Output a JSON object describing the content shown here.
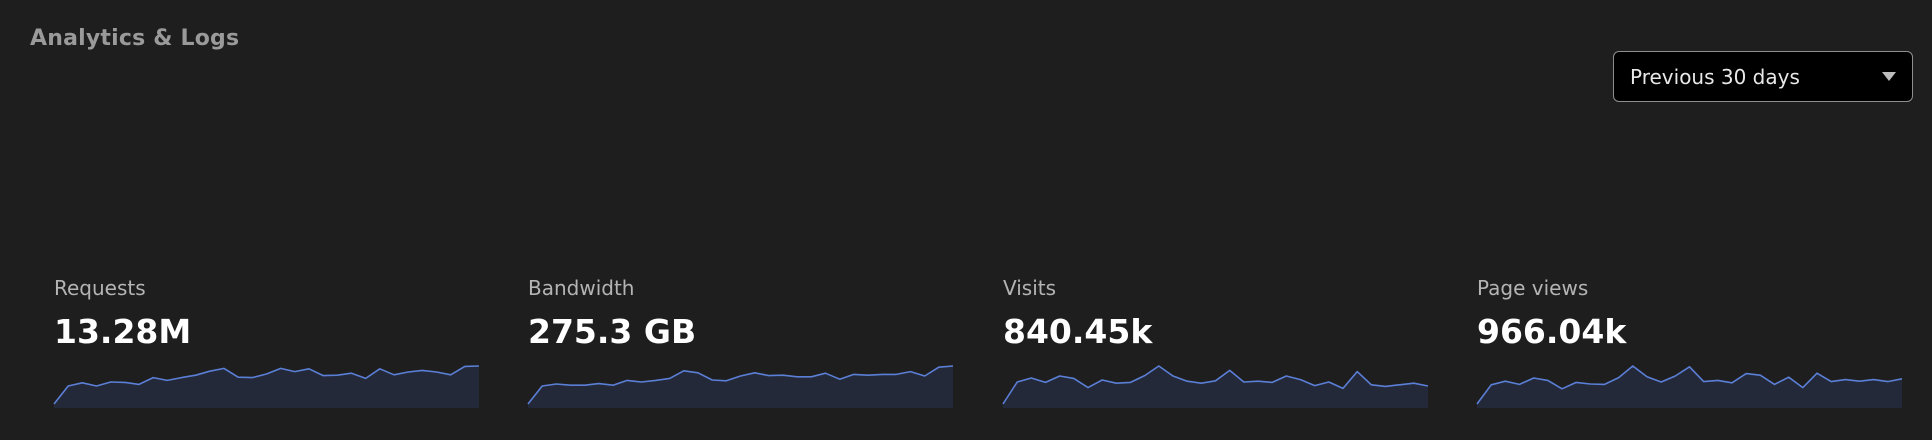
{
  "header": {
    "title": "Analytics & Logs"
  },
  "range_select": {
    "value": "Previous 30 days"
  },
  "colors": {
    "background": "#1e1e1e",
    "sparkline_stroke": "#5b7fd6",
    "sparkline_fill": "#232938"
  },
  "stats": [
    {
      "label": "Requests",
      "value": "13.28M",
      "trend": [
        0.05,
        0.5,
        0.58,
        0.5,
        0.6,
        0.59,
        0.54,
        0.71,
        0.64,
        0.71,
        0.77,
        0.87,
        0.94,
        0.72,
        0.71,
        0.8,
        0.94,
        0.86,
        0.93,
        0.76,
        0.77,
        0.82,
        0.69,
        0.93,
        0.78,
        0.85,
        0.89,
        0.85,
        0.78,
        0.99,
        1.0
      ]
    },
    {
      "label": "Bandwidth",
      "value": "275.3 GB",
      "trend": [
        0.05,
        0.5,
        0.55,
        0.52,
        0.52,
        0.56,
        0.52,
        0.64,
        0.6,
        0.64,
        0.69,
        0.88,
        0.83,
        0.65,
        0.63,
        0.75,
        0.83,
        0.76,
        0.77,
        0.73,
        0.73,
        0.82,
        0.67,
        0.79,
        0.77,
        0.79,
        0.79,
        0.86,
        0.75,
        0.97,
        1.0
      ]
    },
    {
      "label": "Visits",
      "value": "840.45k",
      "trend": [
        0.05,
        0.6,
        0.7,
        0.59,
        0.75,
        0.69,
        0.46,
        0.65,
        0.57,
        0.59,
        0.76,
        1.0,
        0.75,
        0.62,
        0.57,
        0.63,
        0.89,
        0.6,
        0.62,
        0.59,
        0.75,
        0.66,
        0.51,
        0.6,
        0.44,
        0.86,
        0.53,
        0.49,
        0.53,
        0.57,
        0.5
      ]
    },
    {
      "label": "Page views",
      "value": "966.04k",
      "trend": [
        0.05,
        0.53,
        0.62,
        0.54,
        0.7,
        0.64,
        0.43,
        0.59,
        0.55,
        0.54,
        0.71,
        1.0,
        0.73,
        0.6,
        0.75,
        0.98,
        0.61,
        0.64,
        0.58,
        0.81,
        0.77,
        0.54,
        0.72,
        0.46,
        0.82,
        0.61,
        0.66,
        0.62,
        0.66,
        0.61,
        0.68
      ]
    }
  ]
}
